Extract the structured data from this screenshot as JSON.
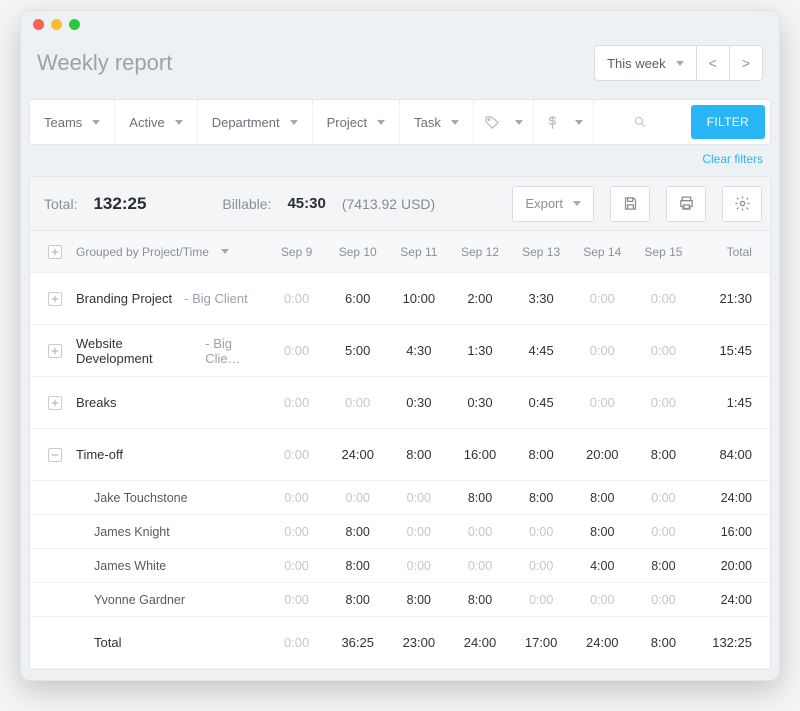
{
  "header": {
    "title": "Weekly report"
  },
  "range": {
    "label": "This week",
    "prev": "<",
    "next": ">"
  },
  "filters": {
    "teams": "Teams",
    "active": "Active",
    "department": "Department",
    "project": "Project",
    "task": "Task",
    "filter_btn": "FILTER",
    "clear": "Clear filters"
  },
  "summary": {
    "total_label": "Total:",
    "total_value": "132:25",
    "billable_label": "Billable:",
    "billable_value": "45:30",
    "billable_amount": "(7413.92 USD)",
    "export": "Export"
  },
  "columns": {
    "group_label": "Grouped by Project/Time",
    "days": [
      "Sep 9",
      "Sep 10",
      "Sep 11",
      "Sep 12",
      "Sep 13",
      "Sep 14",
      "Sep 15"
    ],
    "total": "Total"
  },
  "rows": [
    {
      "type": "project",
      "expand": "plus",
      "name": "Branding Project",
      "client": " - Big Client",
      "values": [
        "0:00",
        "6:00",
        "10:00",
        "2:00",
        "3:30",
        "0:00",
        "0:00"
      ],
      "total": "21:30"
    },
    {
      "type": "project",
      "expand": "plus",
      "name": "Website Development",
      "client": " - Big Clie…",
      "values": [
        "0:00",
        "5:00",
        "4:30",
        "1:30",
        "4:45",
        "0:00",
        "0:00"
      ],
      "total": "15:45"
    },
    {
      "type": "project",
      "expand": "plus",
      "name": "Breaks",
      "client": "",
      "values": [
        "0:00",
        "0:00",
        "0:30",
        "0:30",
        "0:45",
        "0:00",
        "0:00"
      ],
      "total": "1:45"
    },
    {
      "type": "project",
      "expand": "minus",
      "name": "Time-off",
      "client": "",
      "values": [
        "0:00",
        "24:00",
        "8:00",
        "16:00",
        "8:00",
        "20:00",
        "8:00"
      ],
      "total": "84:00"
    },
    {
      "type": "sub",
      "name": "Jake Touchstone",
      "values": [
        "0:00",
        "0:00",
        "0:00",
        "8:00",
        "8:00",
        "8:00",
        "0:00"
      ],
      "total": "24:00"
    },
    {
      "type": "sub",
      "name": "James Knight",
      "values": [
        "0:00",
        "8:00",
        "0:00",
        "0:00",
        "0:00",
        "8:00",
        "0:00"
      ],
      "total": "16:00"
    },
    {
      "type": "sub",
      "name": "James White",
      "values": [
        "0:00",
        "8:00",
        "0:00",
        "0:00",
        "0:00",
        "4:00",
        "8:00"
      ],
      "total": "20:00"
    },
    {
      "type": "sub",
      "name": "Yvonne Gardner",
      "values": [
        "0:00",
        "8:00",
        "8:00",
        "8:00",
        "0:00",
        "0:00",
        "0:00"
      ],
      "total": "24:00"
    },
    {
      "type": "grand",
      "name": "Total",
      "values": [
        "0:00",
        "36:25",
        "23:00",
        "24:00",
        "17:00",
        "24:00",
        "8:00"
      ],
      "total": "132:25"
    }
  ]
}
